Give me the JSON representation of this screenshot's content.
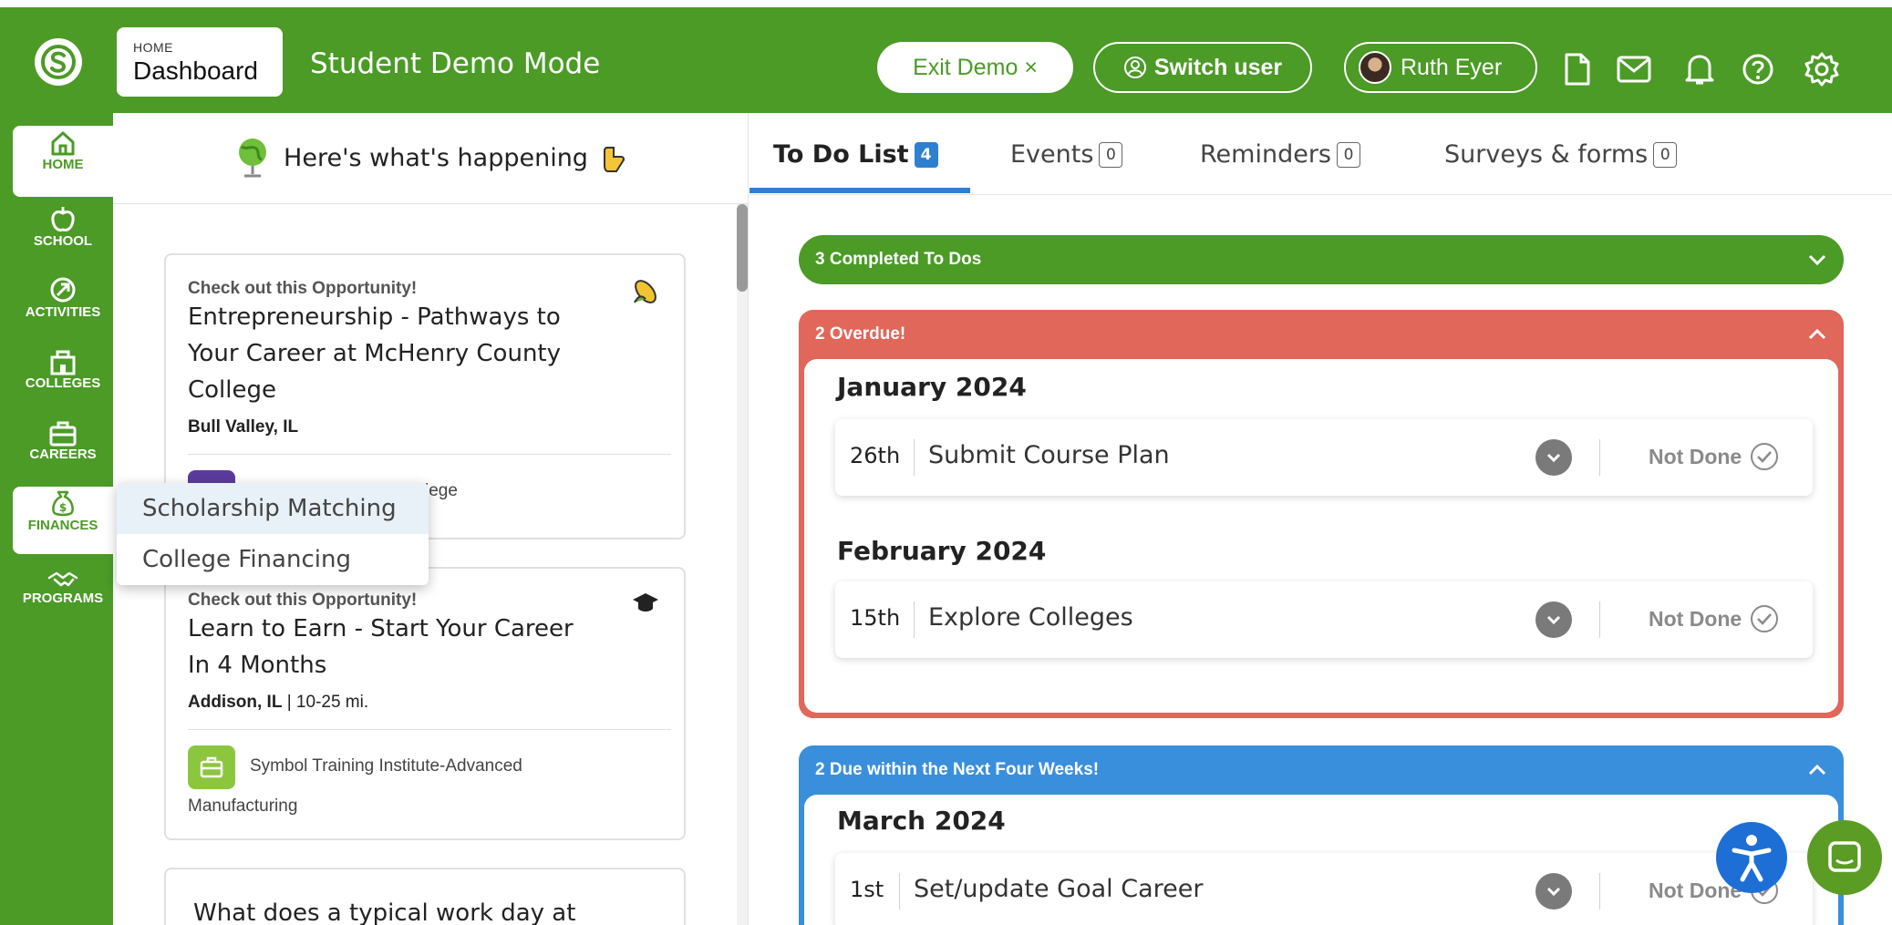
{
  "header": {
    "breadcrumb_small": "HOME",
    "breadcrumb_main": "Dashboard",
    "mode_title": "Student Demo Mode",
    "exit_demo_label": "Exit Demo ×",
    "switch_user_label": "Switch user",
    "user_name": "Ruth Eyer",
    "icons": [
      "document-icon",
      "mail-icon",
      "bell-icon",
      "help-icon",
      "settings-icon"
    ]
  },
  "sidenav": {
    "items": [
      {
        "label": "HOME",
        "icon": "home-icon",
        "active": true
      },
      {
        "label": "SCHOOL",
        "icon": "apple-icon",
        "active": false
      },
      {
        "label": "ACTIVITIES",
        "icon": "activities-icon",
        "active": false
      },
      {
        "label": "COLLEGES",
        "icon": "college-icon",
        "active": false
      },
      {
        "label": "CAREERS",
        "icon": "briefcase-icon",
        "active": false
      },
      {
        "label": "FINANCES",
        "icon": "money-bag-icon",
        "active": true
      },
      {
        "label": "PROGRAMS",
        "icon": "handshake-icon",
        "active": false
      }
    ]
  },
  "finance_menu": {
    "items": [
      "Scholarship Matching",
      "College Financing"
    ]
  },
  "feed": {
    "heading": "Here's what's happening",
    "cards": [
      {
        "label": "Check out this Opportunity!",
        "title_lines": [
          "Entrepreneurship - Pathways to",
          "Your Career at McHenry County",
          "College"
        ],
        "location_bold": "Bull Valley, IL",
        "location_extra": "",
        "org": "lege"
      },
      {
        "label": "Check out this Opportunity!",
        "title_lines": [
          "Learn to Earn - Start Your Career",
          "In 4 Months"
        ],
        "location_bold": "Addison, IL",
        "location_extra": " | 10-25 mi.",
        "org_line1": "Symbol Training Institute-Advanced",
        "org_line2": "Manufacturing"
      },
      {
        "title_partial": "What does a typical work day at"
      }
    ]
  },
  "tabs": [
    {
      "label": "To Do List",
      "count": "4",
      "active": true
    },
    {
      "label": "Events",
      "count": "0",
      "active": false
    },
    {
      "label": "Reminders",
      "count": "0",
      "active": false
    },
    {
      "label": "Surveys & forms",
      "count": "0",
      "active": false
    }
  ],
  "todo": {
    "completed_label": "3 Completed To Dos",
    "overdue_label": "2 Overdue!",
    "overdue_groups": [
      {
        "month": "January 2024",
        "tasks": [
          {
            "day": "26th",
            "name": "Submit Course Plan",
            "status": "Not Done"
          }
        ]
      },
      {
        "month": "February 2024",
        "tasks": [
          {
            "day": "15th",
            "name": "Explore Colleges",
            "status": "Not Done"
          }
        ]
      }
    ],
    "due_label": "2 Due within the Next Four Weeks!",
    "due_groups": [
      {
        "month": "March 2024",
        "tasks": [
          {
            "day": "1st",
            "name": "Set/update Goal Career",
            "status": "Not Done"
          }
        ]
      }
    ]
  },
  "colors": {
    "brand_green": "#4b9b26",
    "overdue_red": "#e0675a",
    "due_blue": "#3a8fdc",
    "tab_blue": "#2f7fd1"
  }
}
